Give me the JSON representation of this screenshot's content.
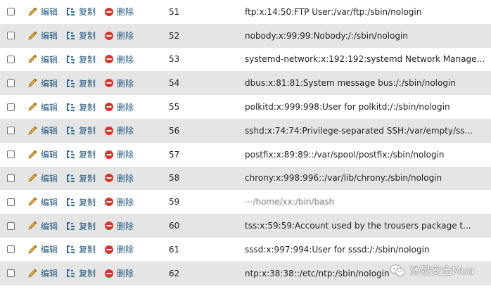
{
  "actions": {
    "edit_label": "编辑",
    "copy_label": "复制",
    "delete_label": "删除"
  },
  "rows": [
    {
      "id": "51",
      "text": "ftp:x:14:50:FTP User:/var/ftp:/sbin/nologin"
    },
    {
      "id": "52",
      "text": "nobody:x:99:99:Nobody:/:/sbin/nologin"
    },
    {
      "id": "53",
      "text": "systemd-network:x:192:192:systemd Network Manageme..."
    },
    {
      "id": "54",
      "text": "dbus:x:81:81:System message bus:/:/sbin/nologin"
    },
    {
      "id": "55",
      "text": "polkitd:x:999:998:User for polkitd:/:/sbin/nologin"
    },
    {
      "id": "56",
      "text": "sshd:x:74:74:Privilege-separated SSH:/var/empty/ss..."
    },
    {
      "id": "57",
      "text": "postfix:x:89:89::/var/spool/postfix:/sbin/nologin"
    },
    {
      "id": "58",
      "text": "chrony:x:998:996::/var/lib/chrony:/sbin/nologin"
    },
    {
      "id": "59",
      "text": "···/home/xx:/bin/bash"
    },
    {
      "id": "60",
      "text": "tss:x:59:59:Account used by the trousers package t..."
    },
    {
      "id": "61",
      "text": "sssd:x:997:994:User for sssd:/:/sbin/nologin"
    },
    {
      "id": "62",
      "text": "ntp:x:38:38::/etc/ntp:/sbin/nologin"
    }
  ],
  "watermark": {
    "text": "沐殁安全Mua",
    "icon": "wechat-icon"
  },
  "colors": {
    "action_link": "#235a81",
    "row_alt_bg": "#e5e5e5",
    "delete_red": "#d9342b",
    "pencil_yellow": "#f1b43b"
  }
}
